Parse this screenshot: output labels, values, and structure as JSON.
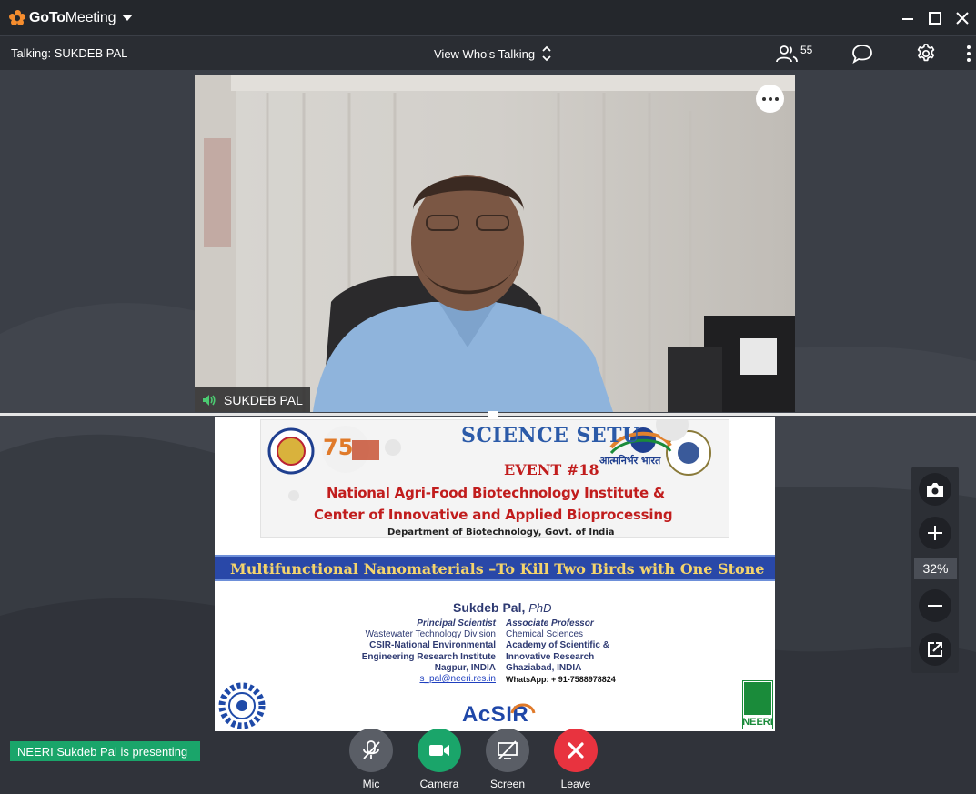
{
  "app": {
    "name_bold": "GoTo",
    "name_rest": "Meeting"
  },
  "toolbar": {
    "talking": "Talking: SUKDEB PAL",
    "view_mode": "View Who's Talking",
    "participants_count": "55"
  },
  "video": {
    "participant_name": "SUKDEB PAL"
  },
  "slide": {
    "banner": {
      "title": "SCIENCE SETU",
      "event": "EVENT #18",
      "line1": "National Agri-Food Biotechnology Institute &",
      "line2": "Center of Innovative and Applied Bioprocessing",
      "line3": "Department of Biotechnology, Govt. of India"
    },
    "talk_title": "Multifunctional Nanomaterials –To Kill Two Birds with One Stone",
    "speaker_name": "Sukdeb Pal",
    "speaker_degree": "PhD",
    "left_col": {
      "role": "Principal Scientist",
      "dept": "Wastewater Technology Division",
      "org1": "CSIR-National Environmental",
      "org2": "Engineering Research Institute",
      "city": "Nagpur, INDIA",
      "email": "s_pal@neeri.res.in"
    },
    "right_col": {
      "role": "Associate Professor",
      "dept": "Chemical Sciences",
      "org1": "Academy of Scientific &",
      "org2": "Innovative Research",
      "city": "Ghaziabad, INDIA",
      "phone": "WhatsApp: + 91-7588978824"
    },
    "acsir": "AcSIR",
    "neeri": "NEERI"
  },
  "zoom": {
    "level": "32%"
  },
  "presenting": "NEERI Sukdeb Pal is presenting",
  "controls": {
    "mic": "Mic",
    "camera": "Camera",
    "screen": "Screen",
    "leave": "Leave"
  },
  "colors": {
    "camera_green": "#1aa56a",
    "leave_red": "#e8333f",
    "presenting_green": "#1aa56a",
    "brand_orange": "#f68d2e"
  }
}
